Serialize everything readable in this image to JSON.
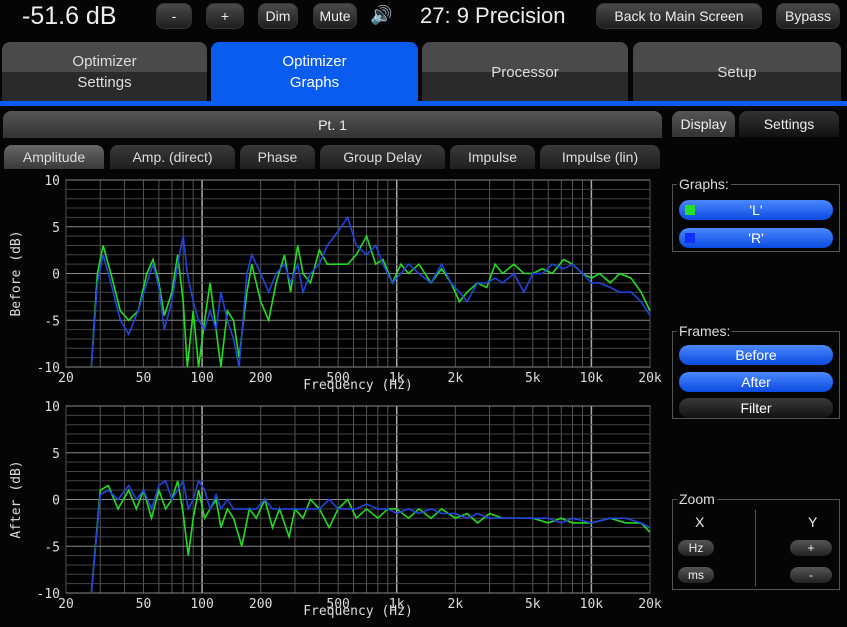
{
  "header": {
    "volume": "-51.6 dB",
    "minus": "-",
    "plus": "+",
    "dim": "Dim",
    "mute": "Mute",
    "preset": "27: 9 Precision",
    "back": "Back to Main Screen",
    "bypass": "Bypass"
  },
  "tabs": [
    "Optimizer Settings",
    "Optimizer Graphs",
    "Processor",
    "Setup"
  ],
  "position_bar": "Pt. 1",
  "subtabs": [
    "Amplitude",
    "Amp. (direct)",
    "Phase",
    "Group Delay",
    "Impulse",
    "Impulse (lin)"
  ],
  "side_tabs": [
    "Display",
    "Settings"
  ],
  "graphs_panel": {
    "label": "Graphs:",
    "items": [
      {
        "label": "'L'",
        "color": "#22e022"
      },
      {
        "label": "'R'",
        "color": "#1030ff"
      }
    ]
  },
  "frames_panel": {
    "label": "Frames:",
    "items": [
      "Before",
      "After",
      "Filter"
    ]
  },
  "zoom_panel": {
    "label": "Zoom",
    "x": "X",
    "y": "Y",
    "hz": "Hz",
    "ms": "ms",
    "plus": "+",
    "minus": "-"
  },
  "chart_data": [
    {
      "type": "line",
      "ylabel": "Before (dB)",
      "xlabel": "Frequency (Hz)",
      "xscale": "log",
      "xlim": [
        20,
        20000
      ],
      "ylim": [
        -10,
        10
      ],
      "xticks": [
        "20",
        "50",
        "100",
        "200",
        "500",
        "1k",
        "2k",
        "5k",
        "10k",
        "20k"
      ],
      "yticks": [
        "10",
        "5",
        "0",
        "-5",
        "-10"
      ],
      "series": [
        {
          "name": "L",
          "color": "#22dd22",
          "points": [
            [
              27,
              -10
            ],
            [
              29,
              0
            ],
            [
              31,
              3
            ],
            [
              34,
              0
            ],
            [
              38,
              -4
            ],
            [
              42,
              -5
            ],
            [
              47,
              -4
            ],
            [
              52,
              0
            ],
            [
              56,
              1.5
            ],
            [
              60,
              -1
            ],
            [
              64,
              -4.5
            ],
            [
              70,
              -2
            ],
            [
              75,
              2
            ],
            [
              80,
              -3
            ],
            [
              84,
              -10
            ],
            [
              90,
              -4
            ],
            [
              96,
              -10
            ],
            [
              103,
              -5
            ],
            [
              110,
              -1
            ],
            [
              118,
              -6
            ],
            [
              125,
              -10
            ],
            [
              135,
              -4
            ],
            [
              145,
              -5
            ],
            [
              155,
              -9
            ],
            [
              170,
              -2
            ],
            [
              180,
              1
            ],
            [
              200,
              -3
            ],
            [
              220,
              -5
            ],
            [
              240,
              -1
            ],
            [
              265,
              2
            ],
            [
              285,
              -2
            ],
            [
              310,
              3
            ],
            [
              330,
              0
            ],
            [
              360,
              -1
            ],
            [
              400,
              2.5
            ],
            [
              440,
              1
            ],
            [
              500,
              1
            ],
            [
              560,
              1
            ],
            [
              620,
              2
            ],
            [
              700,
              4
            ],
            [
              780,
              1
            ],
            [
              850,
              1.5
            ],
            [
              950,
              -1
            ],
            [
              1050,
              1
            ],
            [
              1150,
              0
            ],
            [
              1300,
              1
            ],
            [
              1500,
              -1
            ],
            [
              1700,
              0.5
            ],
            [
              1900,
              -1
            ],
            [
              2100,
              -3
            ],
            [
              2300,
              -2
            ],
            [
              2600,
              -1
            ],
            [
              2900,
              -1.5
            ],
            [
              3200,
              1
            ],
            [
              3500,
              0
            ],
            [
              4000,
              1
            ],
            [
              4500,
              0
            ],
            [
              5000,
              0
            ],
            [
              5600,
              0.5
            ],
            [
              6300,
              0
            ],
            [
              7200,
              1.5
            ],
            [
              8000,
              1
            ],
            [
              9000,
              0
            ],
            [
              10000,
              -0.5
            ],
            [
              11000,
              0
            ],
            [
              12500,
              -1
            ],
            [
              14000,
              0
            ],
            [
              16000,
              -0.5
            ],
            [
              18000,
              -2
            ],
            [
              20000,
              -4
            ]
          ]
        },
        {
          "name": "R",
          "color": "#2244dd",
          "points": [
            [
              27,
              -10
            ],
            [
              29,
              -1
            ],
            [
              31,
              2
            ],
            [
              34,
              -1
            ],
            [
              38,
              -5
            ],
            [
              42,
              -6.5
            ],
            [
              47,
              -4
            ],
            [
              52,
              -1
            ],
            [
              56,
              1
            ],
            [
              60,
              -1.5
            ],
            [
              64,
              -6
            ],
            [
              70,
              -3
            ],
            [
              75,
              1
            ],
            [
              80,
              4
            ],
            [
              84,
              0
            ],
            [
              90,
              -3
            ],
            [
              96,
              -5
            ],
            [
              103,
              -6
            ],
            [
              110,
              -4
            ],
            [
              118,
              -6
            ],
            [
              125,
              -2
            ],
            [
              135,
              -5
            ],
            [
              145,
              -7
            ],
            [
              155,
              -10
            ],
            [
              170,
              0
            ],
            [
              180,
              2
            ],
            [
              200,
              0
            ],
            [
              220,
              -2
            ],
            [
              240,
              0
            ],
            [
              265,
              1
            ],
            [
              285,
              -1
            ],
            [
              310,
              1
            ],
            [
              330,
              -2
            ],
            [
              360,
              0
            ],
            [
              400,
              1
            ],
            [
              440,
              3
            ],
            [
              500,
              4.5
            ],
            [
              560,
              6
            ],
            [
              620,
              3
            ],
            [
              700,
              2
            ],
            [
              780,
              3
            ],
            [
              850,
              1
            ],
            [
              950,
              -1
            ],
            [
              1050,
              0
            ],
            [
              1150,
              1
            ],
            [
              1300,
              0
            ],
            [
              1500,
              -1
            ],
            [
              1700,
              1
            ],
            [
              1900,
              -1
            ],
            [
              2100,
              -2
            ],
            [
              2300,
              -3
            ],
            [
              2600,
              -1
            ],
            [
              2900,
              -1
            ],
            [
              3200,
              -0.5
            ],
            [
              3500,
              -1
            ],
            [
              4000,
              0
            ],
            [
              4500,
              -2
            ],
            [
              5000,
              0
            ],
            [
              5600,
              0
            ],
            [
              6300,
              1
            ],
            [
              7200,
              0.5
            ],
            [
              8000,
              1
            ],
            [
              9000,
              0
            ],
            [
              10000,
              -1
            ],
            [
              11000,
              -1
            ],
            [
              12500,
              -1.5
            ],
            [
              14000,
              -2
            ],
            [
              16000,
              -2
            ],
            [
              18000,
              -3
            ],
            [
              20000,
              -4.5
            ]
          ]
        }
      ]
    },
    {
      "type": "line",
      "ylabel": "After (dB)",
      "xlabel": "Frequency (Hz)",
      "xscale": "log",
      "xlim": [
        20,
        20000
      ],
      "ylim": [
        -10,
        10
      ],
      "xticks": [
        "20",
        "50",
        "100",
        "200",
        "500",
        "1k",
        "2k",
        "5k",
        "10k",
        "20k"
      ],
      "yticks": [
        "10",
        "5",
        "0",
        "-5",
        "-10"
      ],
      "series": [
        {
          "name": "L",
          "color": "#22dd22",
          "points": [
            [
              27,
              -10
            ],
            [
              30,
              1
            ],
            [
              33,
              1.5
            ],
            [
              37,
              -1
            ],
            [
              42,
              1
            ],
            [
              46,
              -1
            ],
            [
              50,
              1
            ],
            [
              55,
              -2
            ],
            [
              60,
              1
            ],
            [
              65,
              -1
            ],
            [
              70,
              0
            ],
            [
              75,
              2
            ],
            [
              80,
              -1.5
            ],
            [
              85,
              -6
            ],
            [
              90,
              -2
            ],
            [
              96,
              1
            ],
            [
              103,
              -2
            ],
            [
              110,
              -1
            ],
            [
              118,
              0
            ],
            [
              125,
              -3
            ],
            [
              135,
              -1
            ],
            [
              145,
              -2
            ],
            [
              160,
              -5
            ],
            [
              175,
              -1
            ],
            [
              190,
              -2
            ],
            [
              210,
              0
            ],
            [
              230,
              -3
            ],
            [
              250,
              -1
            ],
            [
              280,
              -4
            ],
            [
              300,
              -1
            ],
            [
              330,
              -2
            ],
            [
              360,
              0
            ],
            [
              400,
              -1
            ],
            [
              450,
              -3
            ],
            [
              500,
              -1
            ],
            [
              560,
              0
            ],
            [
              620,
              -2
            ],
            [
              700,
              -1
            ],
            [
              800,
              -2
            ],
            [
              900,
              -1
            ],
            [
              1000,
              -1
            ],
            [
              1150,
              -2
            ],
            [
              1300,
              -1
            ],
            [
              1500,
              -2
            ],
            [
              1700,
              -1
            ],
            [
              2000,
              -2
            ],
            [
              2300,
              -1.5
            ],
            [
              2600,
              -2.5
            ],
            [
              3000,
              -1.5
            ],
            [
              3500,
              -2
            ],
            [
              4000,
              -2
            ],
            [
              5000,
              -2
            ],
            [
              6000,
              -2.5
            ],
            [
              7000,
              -2
            ],
            [
              8000,
              -2.5
            ],
            [
              10000,
              -2.5
            ],
            [
              12500,
              -2
            ],
            [
              15000,
              -2.5
            ],
            [
              18000,
              -2.5
            ],
            [
              20000,
              -3.5
            ]
          ]
        },
        {
          "name": "R",
          "color": "#2244dd",
          "points": [
            [
              27,
              -10
            ],
            [
              30,
              0.5
            ],
            [
              33,
              1
            ],
            [
              37,
              0
            ],
            [
              42,
              1.5
            ],
            [
              46,
              0
            ],
            [
              50,
              1
            ],
            [
              55,
              -1
            ],
            [
              60,
              1.5
            ],
            [
              65,
              2
            ],
            [
              70,
              0
            ],
            [
              75,
              1
            ],
            [
              80,
              2
            ],
            [
              85,
              -1
            ],
            [
              90,
              0
            ],
            [
              96,
              2
            ],
            [
              103,
              1
            ],
            [
              110,
              -1
            ],
            [
              118,
              0.5
            ],
            [
              125,
              -1
            ],
            [
              135,
              0
            ],
            [
              145,
              -1
            ],
            [
              160,
              -1
            ],
            [
              175,
              -1
            ],
            [
              190,
              -1
            ],
            [
              210,
              0
            ],
            [
              230,
              -1
            ],
            [
              250,
              -1
            ],
            [
              280,
              -1
            ],
            [
              300,
              -1
            ],
            [
              330,
              -1
            ],
            [
              360,
              -1
            ],
            [
              400,
              -1
            ],
            [
              450,
              0
            ],
            [
              500,
              -1
            ],
            [
              560,
              -1
            ],
            [
              620,
              -1
            ],
            [
              700,
              -0.5
            ],
            [
              800,
              -1
            ],
            [
              900,
              -1
            ],
            [
              1000,
              -1.5
            ],
            [
              1150,
              -1
            ],
            [
              1300,
              -1.5
            ],
            [
              1500,
              -1
            ],
            [
              1700,
              -1.5
            ],
            [
              2000,
              -1.5
            ],
            [
              2300,
              -2
            ],
            [
              2600,
              -1.5
            ],
            [
              3000,
              -2
            ],
            [
              3500,
              -2
            ],
            [
              4000,
              -2
            ],
            [
              5000,
              -2
            ],
            [
              6000,
              -2
            ],
            [
              7000,
              -2.5
            ],
            [
              8000,
              -2
            ],
            [
              10000,
              -2.5
            ],
            [
              12500,
              -2
            ],
            [
              15000,
              -2
            ],
            [
              18000,
              -2.5
            ],
            [
              20000,
              -3
            ]
          ]
        }
      ]
    }
  ]
}
